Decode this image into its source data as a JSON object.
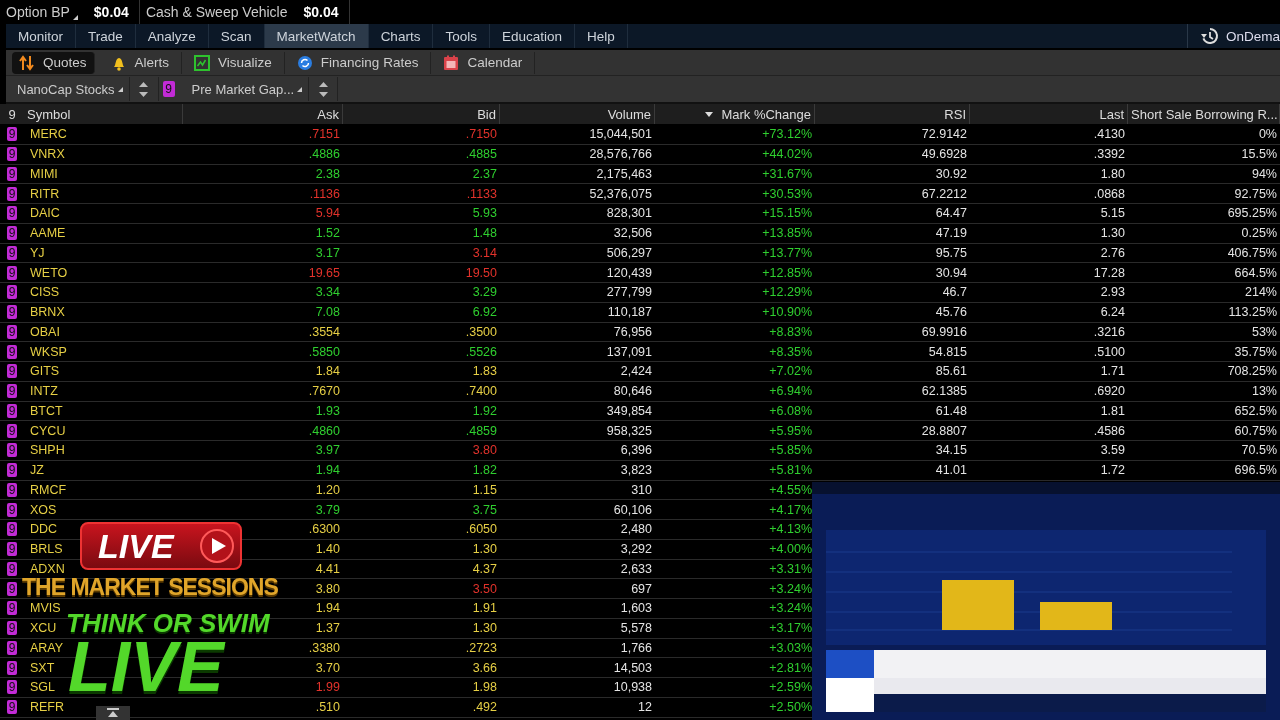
{
  "account_bar": [
    {
      "label": "Option BP",
      "value": "$0.04",
      "dropdown": true
    },
    {
      "label": "Cash & Sweep Vehicle",
      "value": "$0.04",
      "dropdown": false
    }
  ],
  "menu": {
    "tabs": [
      {
        "label": "Monitor",
        "selected": false
      },
      {
        "label": "Trade",
        "selected": false
      },
      {
        "label": "Analyze",
        "selected": false
      },
      {
        "label": "Scan",
        "selected": false
      },
      {
        "label": "MarketWatch",
        "selected": true
      },
      {
        "label": "Charts",
        "selected": false
      },
      {
        "label": "Tools",
        "selected": false
      },
      {
        "label": "Education",
        "selected": false
      },
      {
        "label": "Help",
        "selected": false
      }
    ],
    "on_demand": "OnDema"
  },
  "subtabs": [
    {
      "label": "Quotes",
      "kind": "quotes",
      "selected": true
    },
    {
      "label": "Alerts",
      "kind": "alerts",
      "selected": false
    },
    {
      "label": "Visualize",
      "kind": "visualize",
      "selected": false
    },
    {
      "label": "Financing Rates",
      "kind": "financing",
      "selected": false
    },
    {
      "label": "Calendar",
      "kind": "calendar",
      "selected": false
    }
  ],
  "watchlist_bar": {
    "list": "NanoCap Stocks",
    "group": "9",
    "scan": "Pre Market Gap..."
  },
  "table": {
    "group": "9",
    "columns": [
      {
        "label": "Symbol",
        "sorted": false
      },
      {
        "label": "Ask",
        "sorted": false
      },
      {
        "label": "Bid",
        "sorted": false
      },
      {
        "label": "Volume",
        "sorted": false
      },
      {
        "label": "Mark %Change",
        "sorted": true
      },
      {
        "label": "RSI",
        "sorted": false
      },
      {
        "label": "Last",
        "sorted": false
      },
      {
        "label": "Short Sale Borrowing R...",
        "sorted": false
      }
    ],
    "rows": [
      {
        "group": "9",
        "symbol": "MERC",
        "ask": {
          "text": ".7151",
          "color": "#e2322b"
        },
        "bid": {
          "text": ".7150",
          "color": "#e2322b"
        },
        "volume": "15,044,501",
        "change": "+73.12%",
        "rsi": "72.9142",
        "last": ".4130",
        "short_rate": "0%"
      },
      {
        "group": "9",
        "symbol": "VNRX",
        "ask": {
          "text": ".4886",
          "color": "#2fcf2f"
        },
        "bid": {
          "text": ".4885",
          "color": "#2fcf2f"
        },
        "volume": "28,576,766",
        "change": "+44.02%",
        "rsi": "49.6928",
        "last": ".3392",
        "short_rate": "15.5%"
      },
      {
        "group": "9",
        "symbol": "MIMI",
        "ask": {
          "text": "2.38",
          "color": "#2fcf2f"
        },
        "bid": {
          "text": "2.37",
          "color": "#2fcf2f"
        },
        "volume": "2,175,463",
        "change": "+31.67%",
        "rsi": "30.92",
        "last": "1.80",
        "short_rate": "94%"
      },
      {
        "group": "9",
        "symbol": "RITR",
        "ask": {
          "text": ".1136",
          "color": "#e2322b"
        },
        "bid": {
          "text": ".1133",
          "color": "#e2322b"
        },
        "volume": "52,376,075",
        "change": "+30.53%",
        "rsi": "67.2212",
        "last": ".0868",
        "short_rate": "92.75%"
      },
      {
        "group": "9",
        "symbol": "DAIC",
        "ask": {
          "text": "5.94",
          "color": "#e2322b"
        },
        "bid": {
          "text": "5.93",
          "color": "#2fcf2f"
        },
        "volume": "828,301",
        "change": "+15.15%",
        "rsi": "64.47",
        "last": "5.15",
        "short_rate": "695.25%"
      },
      {
        "group": "9",
        "symbol": "AAME",
        "ask": {
          "text": "1.52",
          "color": "#2fcf2f"
        },
        "bid": {
          "text": "1.48",
          "color": "#2fcf2f"
        },
        "volume": "32,506",
        "change": "+13.85%",
        "rsi": "47.19",
        "last": "1.30",
        "short_rate": "0.25%"
      },
      {
        "group": "9",
        "symbol": "YJ",
        "ask": {
          "text": "3.17",
          "color": "#2fcf2f"
        },
        "bid": {
          "text": "3.14",
          "color": "#e2322b"
        },
        "volume": "506,297",
        "change": "+13.77%",
        "rsi": "95.75",
        "last": "2.76",
        "short_rate": "406.75%"
      },
      {
        "group": "9",
        "symbol": "WETO",
        "ask": {
          "text": "19.65",
          "color": "#e2322b"
        },
        "bid": {
          "text": "19.50",
          "color": "#e2322b"
        },
        "volume": "120,439",
        "change": "+12.85%",
        "rsi": "30.94",
        "last": "17.28",
        "short_rate": "664.5%"
      },
      {
        "group": "9",
        "symbol": "CISS",
        "ask": {
          "text": "3.34",
          "color": "#2fcf2f"
        },
        "bid": {
          "text": "3.29",
          "color": "#2fcf2f"
        },
        "volume": "277,799",
        "change": "+12.29%",
        "rsi": "46.7",
        "last": "2.93",
        "short_rate": "214%"
      },
      {
        "group": "9",
        "symbol": "BRNX",
        "ask": {
          "text": "7.08",
          "color": "#2fcf2f"
        },
        "bid": {
          "text": "6.92",
          "color": "#2fcf2f"
        },
        "volume": "110,187",
        "change": "+10.90%",
        "rsi": "45.76",
        "last": "6.24",
        "short_rate": "113.25%"
      },
      {
        "group": "9",
        "symbol": "OBAI",
        "ask": {
          "text": ".3554",
          "color": "#e6cf45"
        },
        "bid": {
          "text": ".3500",
          "color": "#e6cf45"
        },
        "volume": "76,956",
        "change": "+8.83%",
        "rsi": "69.9916",
        "last": ".3216",
        "short_rate": "53%"
      },
      {
        "group": "9",
        "symbol": "WKSP",
        "ask": {
          "text": ".5850",
          "color": "#2fcf2f"
        },
        "bid": {
          "text": ".5526",
          "color": "#2fcf2f"
        },
        "volume": "137,091",
        "change": "+8.35%",
        "rsi": "54.815",
        "last": ".5100",
        "short_rate": "35.75%"
      },
      {
        "group": "9",
        "symbol": "GITS",
        "ask": {
          "text": "1.84",
          "color": "#e6cf45"
        },
        "bid": {
          "text": "1.83",
          "color": "#e6cf45"
        },
        "volume": "2,424",
        "change": "+7.02%",
        "rsi": "85.61",
        "last": "1.71",
        "short_rate": "708.25%"
      },
      {
        "group": "9",
        "symbol": "INTZ",
        "ask": {
          "text": ".7670",
          "color": "#e6cf45"
        },
        "bid": {
          "text": ".7400",
          "color": "#e6cf45"
        },
        "volume": "80,646",
        "change": "+6.94%",
        "rsi": "62.1385",
        "last": ".6920",
        "short_rate": "13%"
      },
      {
        "group": "9",
        "symbol": "BTCT",
        "ask": {
          "text": "1.93",
          "color": "#2fcf2f"
        },
        "bid": {
          "text": "1.92",
          "color": "#2fcf2f"
        },
        "volume": "349,854",
        "change": "+6.08%",
        "rsi": "61.48",
        "last": "1.81",
        "short_rate": "652.5%"
      },
      {
        "group": "9",
        "symbol": "CYCU",
        "ask": {
          "text": ".4860",
          "color": "#2fcf2f"
        },
        "bid": {
          "text": ".4859",
          "color": "#2fcf2f"
        },
        "volume": "958,325",
        "change": "+5.95%",
        "rsi": "28.8807",
        "last": ".4586",
        "short_rate": "60.75%"
      },
      {
        "group": "9",
        "symbol": "SHPH",
        "ask": {
          "text": "3.97",
          "color": "#2fcf2f"
        },
        "bid": {
          "text": "3.80",
          "color": "#e2322b"
        },
        "volume": "6,396",
        "change": "+5.85%",
        "rsi": "34.15",
        "last": "3.59",
        "short_rate": "70.5%"
      },
      {
        "group": "9",
        "symbol": "JZ",
        "ask": {
          "text": "1.94",
          "color": "#2fcf2f"
        },
        "bid": {
          "text": "1.82",
          "color": "#2fcf2f"
        },
        "volume": "3,823",
        "change": "+5.81%",
        "rsi": "41.01",
        "last": "1.72",
        "short_rate": "696.5%"
      },
      {
        "group": "9",
        "symbol": "RMCF",
        "ask": {
          "text": "1.20",
          "color": "#e6cf45"
        },
        "bid": {
          "text": "1.15",
          "color": "#e6cf45"
        },
        "volume": "310",
        "change": "+4.55%"
      },
      {
        "group": "9",
        "symbol": "XOS",
        "ask": {
          "text": "3.79",
          "color": "#2fcf2f"
        },
        "bid": {
          "text": "3.75",
          "color": "#2fcf2f"
        },
        "volume": "60,106",
        "change": "+4.17%"
      },
      {
        "group": "9",
        "symbol": "DDC",
        "ask": {
          "text": ".6300",
          "color": "#e6cf45"
        },
        "bid": {
          "text": ".6050",
          "color": "#e6cf45"
        },
        "volume": "2,480",
        "change": "+4.13%"
      },
      {
        "group": "9",
        "symbol": "BRLS",
        "ask": {
          "text": "1.40",
          "color": "#e6cf45"
        },
        "bid": {
          "text": "1.30",
          "color": "#e6cf45"
        },
        "volume": "3,292",
        "change": "+4.00%"
      },
      {
        "group": "9",
        "symbol": "ADXN",
        "ask": {
          "text": "4.41",
          "color": "#e6cf45"
        },
        "bid": {
          "text": "4.37",
          "color": "#e6cf45"
        },
        "volume": "2,633",
        "change": "+3.31%"
      },
      {
        "group": "9",
        "ask": {
          "text": "3.80",
          "color": "#e6cf45"
        },
        "bid": {
          "text": "3.50",
          "color": "#e2322b"
        },
        "volume": "697",
        "change": "+3.24%"
      },
      {
        "group": "9",
        "symbol": "MVIS",
        "ask": {
          "text": "1.94",
          "color": "#e6cf45"
        },
        "bid": {
          "text": "1.91",
          "color": "#e6cf45"
        },
        "volume": "1,603",
        "change": "+3.24%"
      },
      {
        "group": "9",
        "symbol": "XCU",
        "ask": {
          "text": "1.37",
          "color": "#e6cf45"
        },
        "bid": {
          "text": "1.30",
          "color": "#e6cf45"
        },
        "volume": "5,578",
        "change": "+3.17%"
      },
      {
        "group": "9",
        "symbol": "ARAY",
        "ask": {
          "text": ".3380",
          "color": "#e6cf45"
        },
        "bid": {
          "text": ".2723",
          "color": "#e6cf45"
        },
        "volume": "1,766",
        "change": "+3.03%"
      },
      {
        "group": "9",
        "symbol": "SXT",
        "ask": {
          "text": "3.70",
          "color": "#e6cf45"
        },
        "bid": {
          "text": "3.66",
          "color": "#e6cf45"
        },
        "volume": "14,503",
        "change": "+2.81%"
      },
      {
        "group": "9",
        "symbol": "SGL",
        "ask": {
          "text": "1.99",
          "color": "#e2322b"
        },
        "bid": {
          "text": "1.98",
          "color": "#e6cf45"
        },
        "volume": "10,938",
        "change": "+2.59%"
      },
      {
        "group": "9",
        "symbol": "REFR",
        "ask": {
          "text": ".510",
          "color": "#e6cf45"
        },
        "bid": {
          "text": ".492",
          "color": "#e6cf45"
        },
        "volume": "12",
        "change": "+2.50%"
      }
    ]
  },
  "stream_overlay": {
    "badge": "LIVE",
    "title": "THE MARKET SESSIONS",
    "subtitle": "THINK OR SWIM",
    "tagline": "LIVE"
  }
}
